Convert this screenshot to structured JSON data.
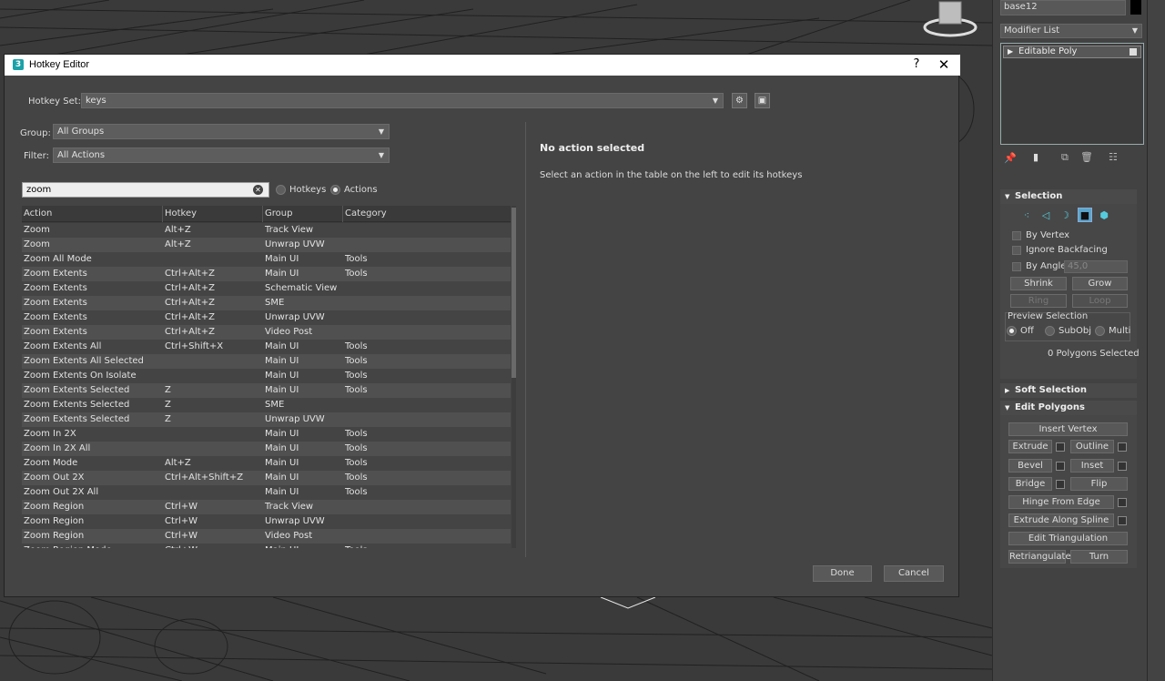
{
  "dialog": {
    "title": "Hotkey Editor",
    "help": "?",
    "close": "✕",
    "hotkey_set_label": "Hotkey Set:",
    "hotkey_set_value": "keys",
    "group_label": "Group:",
    "group_value": "All Groups",
    "filter_label": "Filter:",
    "filter_value": "All Actions",
    "search_value": "zoom",
    "radio_hotkeys": "Hotkeys",
    "radio_actions": "Actions",
    "columns": [
      "Action",
      "Hotkey",
      "Group",
      "Category"
    ],
    "rows": [
      [
        "Zoom",
        "Alt+Z",
        "Track View",
        ""
      ],
      [
        "Zoom",
        "Alt+Z",
        "Unwrap UVW",
        ""
      ],
      [
        "Zoom All Mode",
        "",
        "Main UI",
        "Tools"
      ],
      [
        "Zoom Extents",
        "Ctrl+Alt+Z",
        "Main UI",
        "Tools"
      ],
      [
        "Zoom Extents",
        "Ctrl+Alt+Z",
        "Schematic View",
        ""
      ],
      [
        "Zoom Extents",
        "Ctrl+Alt+Z",
        "SME",
        ""
      ],
      [
        "Zoom Extents",
        "Ctrl+Alt+Z",
        "Unwrap UVW",
        ""
      ],
      [
        "Zoom Extents",
        "Ctrl+Alt+Z",
        "Video Post",
        ""
      ],
      [
        "Zoom Extents All",
        "Ctrl+Shift+X",
        "Main UI",
        "Tools"
      ],
      [
        "Zoom Extents All Selected",
        "",
        "Main UI",
        "Tools"
      ],
      [
        "Zoom Extents On Isolate",
        "",
        "Main UI",
        "Tools"
      ],
      [
        "Zoom Extents Selected",
        "Z",
        "Main UI",
        "Tools"
      ],
      [
        "Zoom Extents Selected",
        "Z",
        "SME",
        ""
      ],
      [
        "Zoom Extents Selected",
        "Z",
        "Unwrap UVW",
        ""
      ],
      [
        "Zoom In 2X",
        "",
        "Main UI",
        "Tools"
      ],
      [
        "Zoom In 2X All",
        "",
        "Main UI",
        "Tools"
      ],
      [
        "Zoom Mode",
        "Alt+Z",
        "Main UI",
        "Tools"
      ],
      [
        "Zoom Out 2X",
        "Ctrl+Alt+Shift+Z",
        "Main UI",
        "Tools"
      ],
      [
        "Zoom Out 2X All",
        "",
        "Main UI",
        "Tools"
      ],
      [
        "Zoom Region",
        "Ctrl+W",
        "Track View",
        ""
      ],
      [
        "Zoom Region",
        "Ctrl+W",
        "Unwrap UVW",
        ""
      ],
      [
        "Zoom Region",
        "Ctrl+W",
        "Video Post",
        ""
      ],
      [
        "Zoom Region Mode",
        "Ctrl+W",
        "Main UI",
        "Tools"
      ]
    ],
    "detail_title": "No action selected",
    "detail_text": "Select an action in the table on the left to edit its hotkeys",
    "done": "Done",
    "cancel": "Cancel"
  },
  "panel": {
    "object_name": "base12",
    "modifier_list": "Modifier List",
    "stack_item": "Editable Poly",
    "selection_title": "Selection",
    "by_vertex": "By Vertex",
    "ignore_backfacing": "Ignore Backfacing",
    "by_angle": "By Angle:",
    "angle_value": "45,0",
    "shrink": "Shrink",
    "grow": "Grow",
    "ring": "Ring",
    "loop": "Loop",
    "preview_selection": "Preview Selection",
    "preview_off": "Off",
    "preview_subobj": "SubObj",
    "preview_multi": "Multi",
    "polygons_selected": "0 Polygons Selected",
    "soft_selection_title": "Soft Selection",
    "edit_polygons_title": "Edit Polygons",
    "insert_vertex": "Insert Vertex",
    "extrude": "Extrude",
    "outline": "Outline",
    "bevel": "Bevel",
    "inset": "Inset",
    "bridge": "Bridge",
    "flip": "Flip",
    "hinge_from_edge": "Hinge From Edge",
    "extrude_along_spline": "Extrude Along Spline",
    "edit_triangulation": "Edit Triangulation",
    "retriangulate": "Retriangulate",
    "turn": "Turn"
  },
  "colors": {
    "accent": "#5aa6c8",
    "dialog_bg": "#444444",
    "row_alt": "#505050"
  }
}
